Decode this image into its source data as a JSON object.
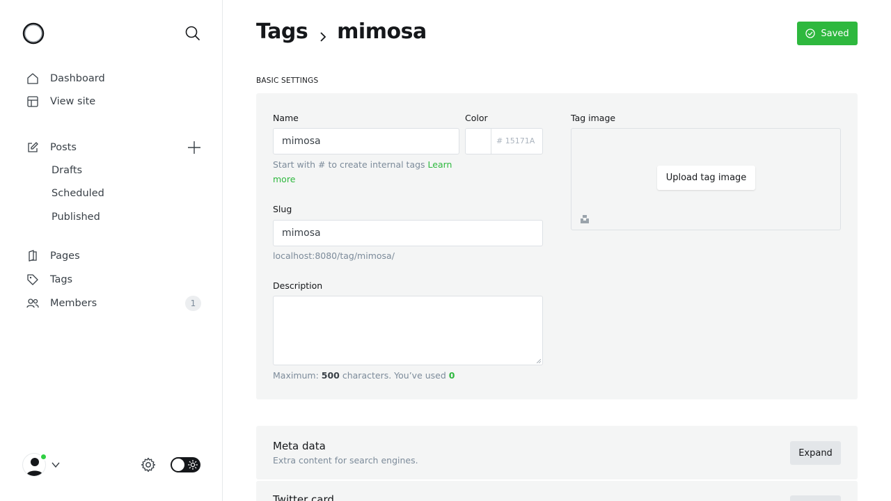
{
  "sidebar": {
    "logo": "ghost-logo",
    "nav": [
      {
        "label": "Dashboard",
        "icon": "home-icon"
      },
      {
        "label": "View site",
        "icon": "layout-icon"
      }
    ],
    "posts": {
      "label": "Posts",
      "icon": "edit-icon",
      "subs": [
        "Drafts",
        "Scheduled",
        "Published"
      ]
    },
    "content_nav": [
      {
        "label": "Pages",
        "icon": "pages-icon"
      },
      {
        "label": "Tags",
        "icon": "tag-icon"
      },
      {
        "label": "Members",
        "icon": "members-icon",
        "count": "1"
      }
    ]
  },
  "header": {
    "breadcrumb_parent": "Tags",
    "breadcrumb_current": "mimosa",
    "save_label": "Saved",
    "accent": "#2eb83e"
  },
  "basic": {
    "section_label": "BASIC SETTINGS",
    "name_label": "Name",
    "name_value": "mimosa",
    "name_hint": "Start with # to create internal tags ",
    "name_hint_link": "Learn more",
    "color_label": "Color",
    "color_placeholder": "# 15171A",
    "slug_label": "Slug",
    "slug_value": "mimosa",
    "slug_url": "localhost:8080/tag/mimosa/",
    "desc_label": "Description",
    "desc_counter_prefix": "Maximum: ",
    "desc_max": "500",
    "desc_counter_mid": " characters. You’ve used ",
    "desc_used": "0",
    "image_label": "Tag image",
    "upload_label": "Upload tag image"
  },
  "meta": {
    "title": "Meta data",
    "desc": "Extra content for search engines.",
    "expand": "Expand"
  },
  "twitter": {
    "title": "Twitter card"
  }
}
